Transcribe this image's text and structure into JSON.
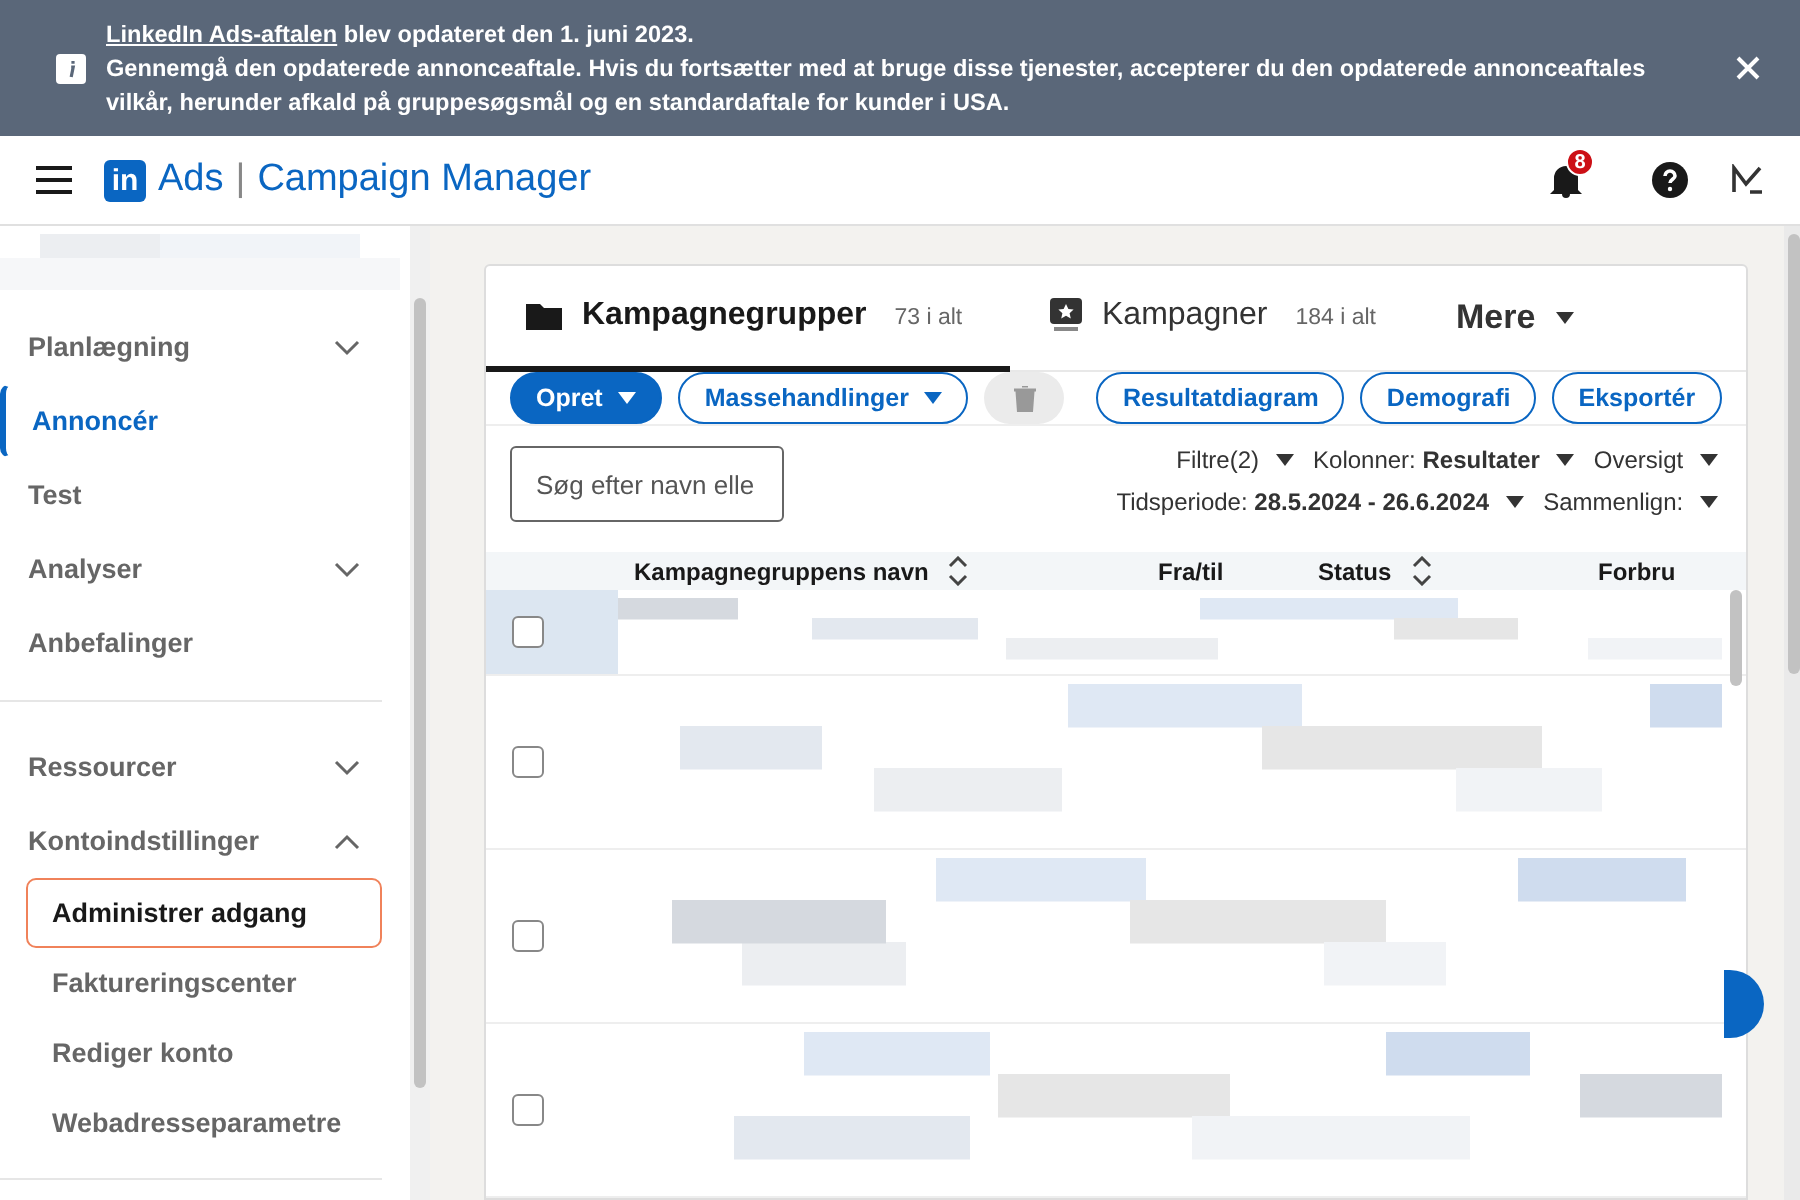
{
  "banner": {
    "link": "LinkedIn Ads-aftalen",
    "headline": " blev opdateret den 1. juni 2023.",
    "message": "Gennemgå den opdaterede annonceaftale. Hvis du fortsætter med at bruge disse tjenester, accepterer du den opdaterede annonceaftales vilkår, herunder afkald på gruppesøgsmål og en standardaftale for kunder i USA."
  },
  "header": {
    "logo": "in",
    "product": "Ads",
    "separator": "|",
    "title": "Campaign Manager",
    "notifications": "8"
  },
  "sidebar": {
    "groups": [
      {
        "items": [
          {
            "label": "Planlægning",
            "kind": "section",
            "expanded": false,
            "selected": false,
            "focused": false
          },
          {
            "label": "Annoncér",
            "kind": "item",
            "selected": true,
            "focused": false
          },
          {
            "label": "Test",
            "kind": "item",
            "selected": false,
            "focused": false
          },
          {
            "label": "Analyser",
            "kind": "section",
            "expanded": false,
            "selected": false,
            "focused": false
          },
          {
            "label": "Anbefalinger",
            "kind": "item",
            "selected": false,
            "focused": false
          }
        ]
      },
      {
        "items": [
          {
            "label": "Ressourcer",
            "kind": "section",
            "expanded": false,
            "selected": false,
            "focused": false
          },
          {
            "label": "Kontoindstillinger",
            "kind": "section",
            "expanded": true,
            "selected": false,
            "focused": false
          },
          {
            "label": "Administrer adgang",
            "kind": "subitem",
            "selected": false,
            "focused": true
          },
          {
            "label": "Faktureringscenter",
            "kind": "subitem",
            "selected": false,
            "focused": false
          },
          {
            "label": "Rediger konto",
            "kind": "subitem",
            "selected": false,
            "focused": false
          },
          {
            "label": "Webadresseparametre",
            "kind": "subitem",
            "selected": false,
            "focused": false
          }
        ]
      }
    ]
  },
  "tabs": [
    {
      "label": "Kampagnegrupper",
      "count": "73 i alt",
      "kind": "folder",
      "selected": true
    },
    {
      "label": "Kampagner",
      "count": "184 i alt",
      "kind": "star",
      "selected": false
    }
  ],
  "more_tab": "Mere",
  "toolbar": [
    {
      "label": "Opret",
      "kind": "primary",
      "caret": true,
      "disabled": false
    },
    {
      "label": "Massehandlinger",
      "kind": "outline",
      "caret": true,
      "disabled": false
    },
    {
      "kind": "delete",
      "caret": false,
      "disabled": true
    }
  ],
  "toolbar_right": [
    "Resultatdiagram",
    "Demografi",
    "Eksportér"
  ],
  "search": {
    "placeholder": "Søg efter navn elle"
  },
  "filters": [
    {
      "label": "Filtre(2)"
    },
    {
      "label": "Kolonner:",
      "value": "Resultater"
    },
    {
      "label": "Oversigt"
    }
  ],
  "filters_2": [
    {
      "label": "Tidsperiode:",
      "value": "28.5.2024 - 26.6.2024"
    },
    {
      "label": "Sammenlign:"
    }
  ],
  "table": {
    "columns": [
      {
        "label": "Kampagnegruppens navn",
        "sortable": true
      },
      {
        "label": "Fra/til",
        "sortable": false
      },
      {
        "label": "Status",
        "sortable": true
      },
      {
        "label": "Forbru",
        "sortable": false
      }
    ],
    "rows": [
      {
        "checked": false,
        "highlighted": true
      },
      {
        "checked": false,
        "highlighted": false
      },
      {
        "checked": false,
        "highlighted": false
      },
      {
        "checked": false,
        "highlighted": false
      }
    ]
  }
}
